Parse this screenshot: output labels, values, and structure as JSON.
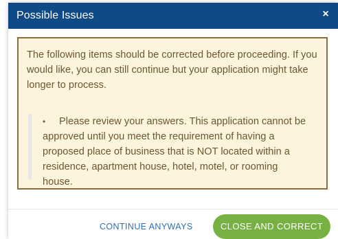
{
  "dialog": {
    "title": "Possible Issues",
    "close_glyph": "×",
    "close_icon": "close-icon"
  },
  "warning": {
    "intro": "The following items should be corrected before proceeding. If you would like, you can still continue but your application might take longer to process.",
    "issues": [
      {
        "bullet": "•",
        "text": "Please review your answers. This application cannot be approved until you meet the requirement of having a proposed place of business that is NOT located within a residence, apartment house, hotel, motel, or rooming house."
      }
    ]
  },
  "footer": {
    "continue_label": "CONTINUE ANYWAYS",
    "primary_label": "CLOSE AND CORRECT"
  },
  "colors": {
    "header_bg": "#0f4a86",
    "warning_bg": "#fcf4dc",
    "warning_border": "#8a6d3b",
    "warning_text": "#6b5632",
    "link": "#2f6fb0",
    "primary_button": "#77b144"
  }
}
